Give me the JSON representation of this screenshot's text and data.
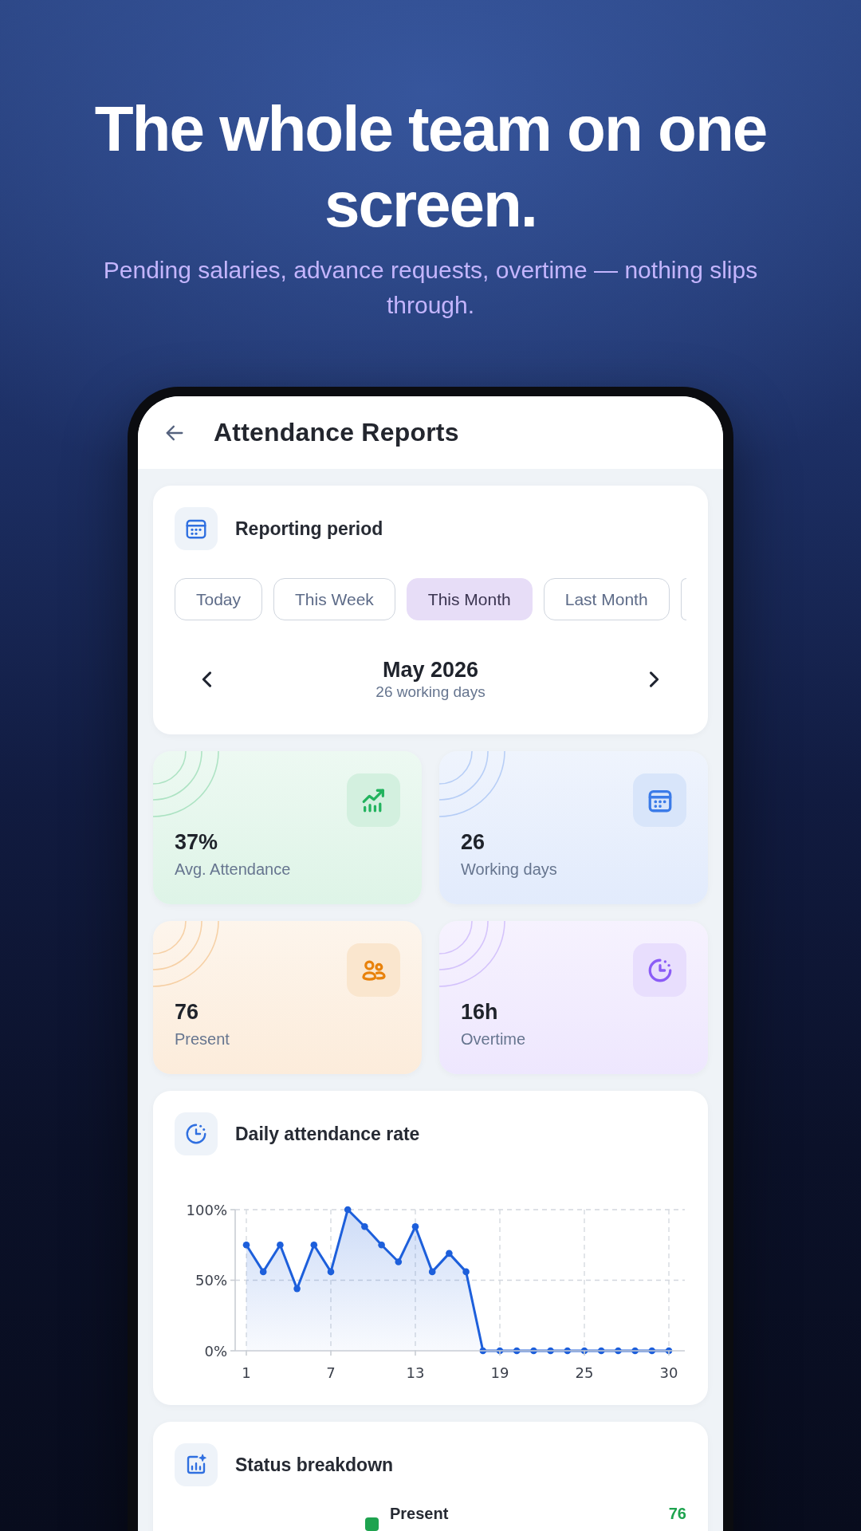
{
  "hero": {
    "title": "The whole team on one screen.",
    "subtitle": "Pending salaries, advance requests, overtime — nothing slips through."
  },
  "app_bar": {
    "title": "Attendance Reports"
  },
  "reporting_period": {
    "title": "Reporting period",
    "chips": [
      {
        "label": "Today",
        "selected": false
      },
      {
        "label": "This Week",
        "selected": false
      },
      {
        "label": "This Month",
        "selected": true
      },
      {
        "label": "Last Month",
        "selected": false
      }
    ],
    "more_chips": true,
    "month": "May 2026",
    "working_days": "26 working days"
  },
  "stats": [
    {
      "kind": "trend",
      "value": "37%",
      "label": "Avg. Attendance",
      "color": "#22b35e"
    },
    {
      "kind": "calendar",
      "value": "26",
      "label": "Working days",
      "color": "#3b7be8"
    },
    {
      "kind": "people",
      "value": "76",
      "label": "Present",
      "color": "#e8820c"
    },
    {
      "kind": "clock",
      "value": "16h",
      "label": "Overtime",
      "color": "#8b5cf6"
    }
  ],
  "daily_rate": {
    "title": "Daily attendance rate",
    "chart_data": {
      "type": "area",
      "grid": true,
      "categories": [
        "1",
        null,
        null,
        null,
        null,
        "7",
        null,
        null,
        null,
        null,
        "13",
        null,
        null,
        null,
        null,
        "19",
        null,
        null,
        null,
        null,
        "25",
        null,
        null,
        null,
        null,
        "30"
      ],
      "ylim": [
        0,
        100
      ],
      "yticks": [
        {
          "value": 0,
          "label": "0%"
        },
        {
          "value": 50,
          "label": "50%"
        },
        {
          "value": 100,
          "label": "100%"
        }
      ],
      "series": [
        {
          "color": "#1d5fdb",
          "values": [
            75,
            56,
            75,
            44,
            75,
            56,
            100,
            88,
            75,
            63,
            88,
            56,
            69,
            56,
            0,
            0,
            0,
            0,
            0,
            0,
            0,
            0,
            0,
            0,
            0,
            0
          ]
        }
      ]
    }
  },
  "status_breakdown": {
    "title": "Status breakdown",
    "items": [
      {
        "label": "Present",
        "value": "76",
        "color": "#1ea34f"
      }
    ]
  }
}
